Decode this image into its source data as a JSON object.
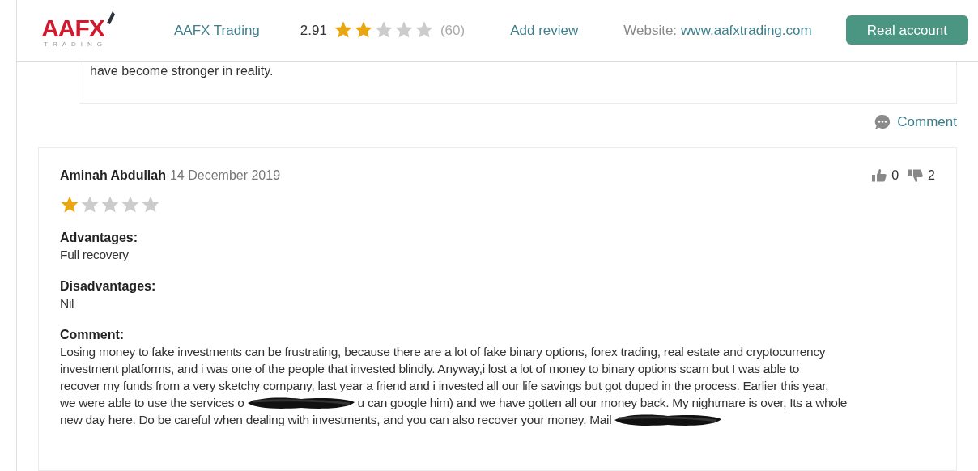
{
  "header": {
    "logo": {
      "main": "AAFX",
      "sub": "TRADING"
    },
    "broker_name": "AAFX Trading",
    "rating": "2.91",
    "stars": 2,
    "review_count": "(60)",
    "add_review": "Add review",
    "website_label": "Website:",
    "website": "www.aafxtrading.com",
    "button": "Real account"
  },
  "previous_review": {
    "last_line": "have become stronger in reality.",
    "comment_link": "Comment"
  },
  "review": {
    "author": "Aminah Abdullah",
    "date": "14 December 2019",
    "stars": 1,
    "likes": "0",
    "dislikes": "2",
    "sections": [
      {
        "heading": "Advantages:",
        "lines": [
          [
            {
              "kind": "text",
              "text": "Full recovery"
            }
          ]
        ]
      },
      {
        "heading": "Disadvantages:",
        "lines": [
          [
            {
              "kind": "text",
              "text": "Nil"
            }
          ]
        ]
      },
      {
        "heading": "Comment:",
        "lines": [
          [
            {
              "kind": "text",
              "text": "Losing money to fake investments can be frustrating, because there are a lot of fake binary options, forex trading, real estate and cryptocurrency"
            }
          ],
          [
            {
              "kind": "text",
              "text": "investment platforms, and i was one of the people that invested blindly. Anyway,i lost a lot of money to binary options scam but I was able to"
            }
          ],
          [
            {
              "kind": "text",
              "text": "recover my funds from a very sketchy company, last year a friend and i invested all our life savings but got duped in the process. Earlier this year,"
            }
          ],
          [
            {
              "kind": "text",
              "text": "we were able to use the services o"
            },
            {
              "kind": "redacted"
            },
            {
              "kind": "text",
              "text": "u can google him) and we have gotten all our money back. My nightmare is over, Its a whole"
            }
          ],
          [
            {
              "kind": "text",
              "text": "new day here. Do be careful when dealing with investments, and you can also recover your money. Mail"
            },
            {
              "kind": "redacted"
            }
          ]
        ]
      }
    ]
  }
}
